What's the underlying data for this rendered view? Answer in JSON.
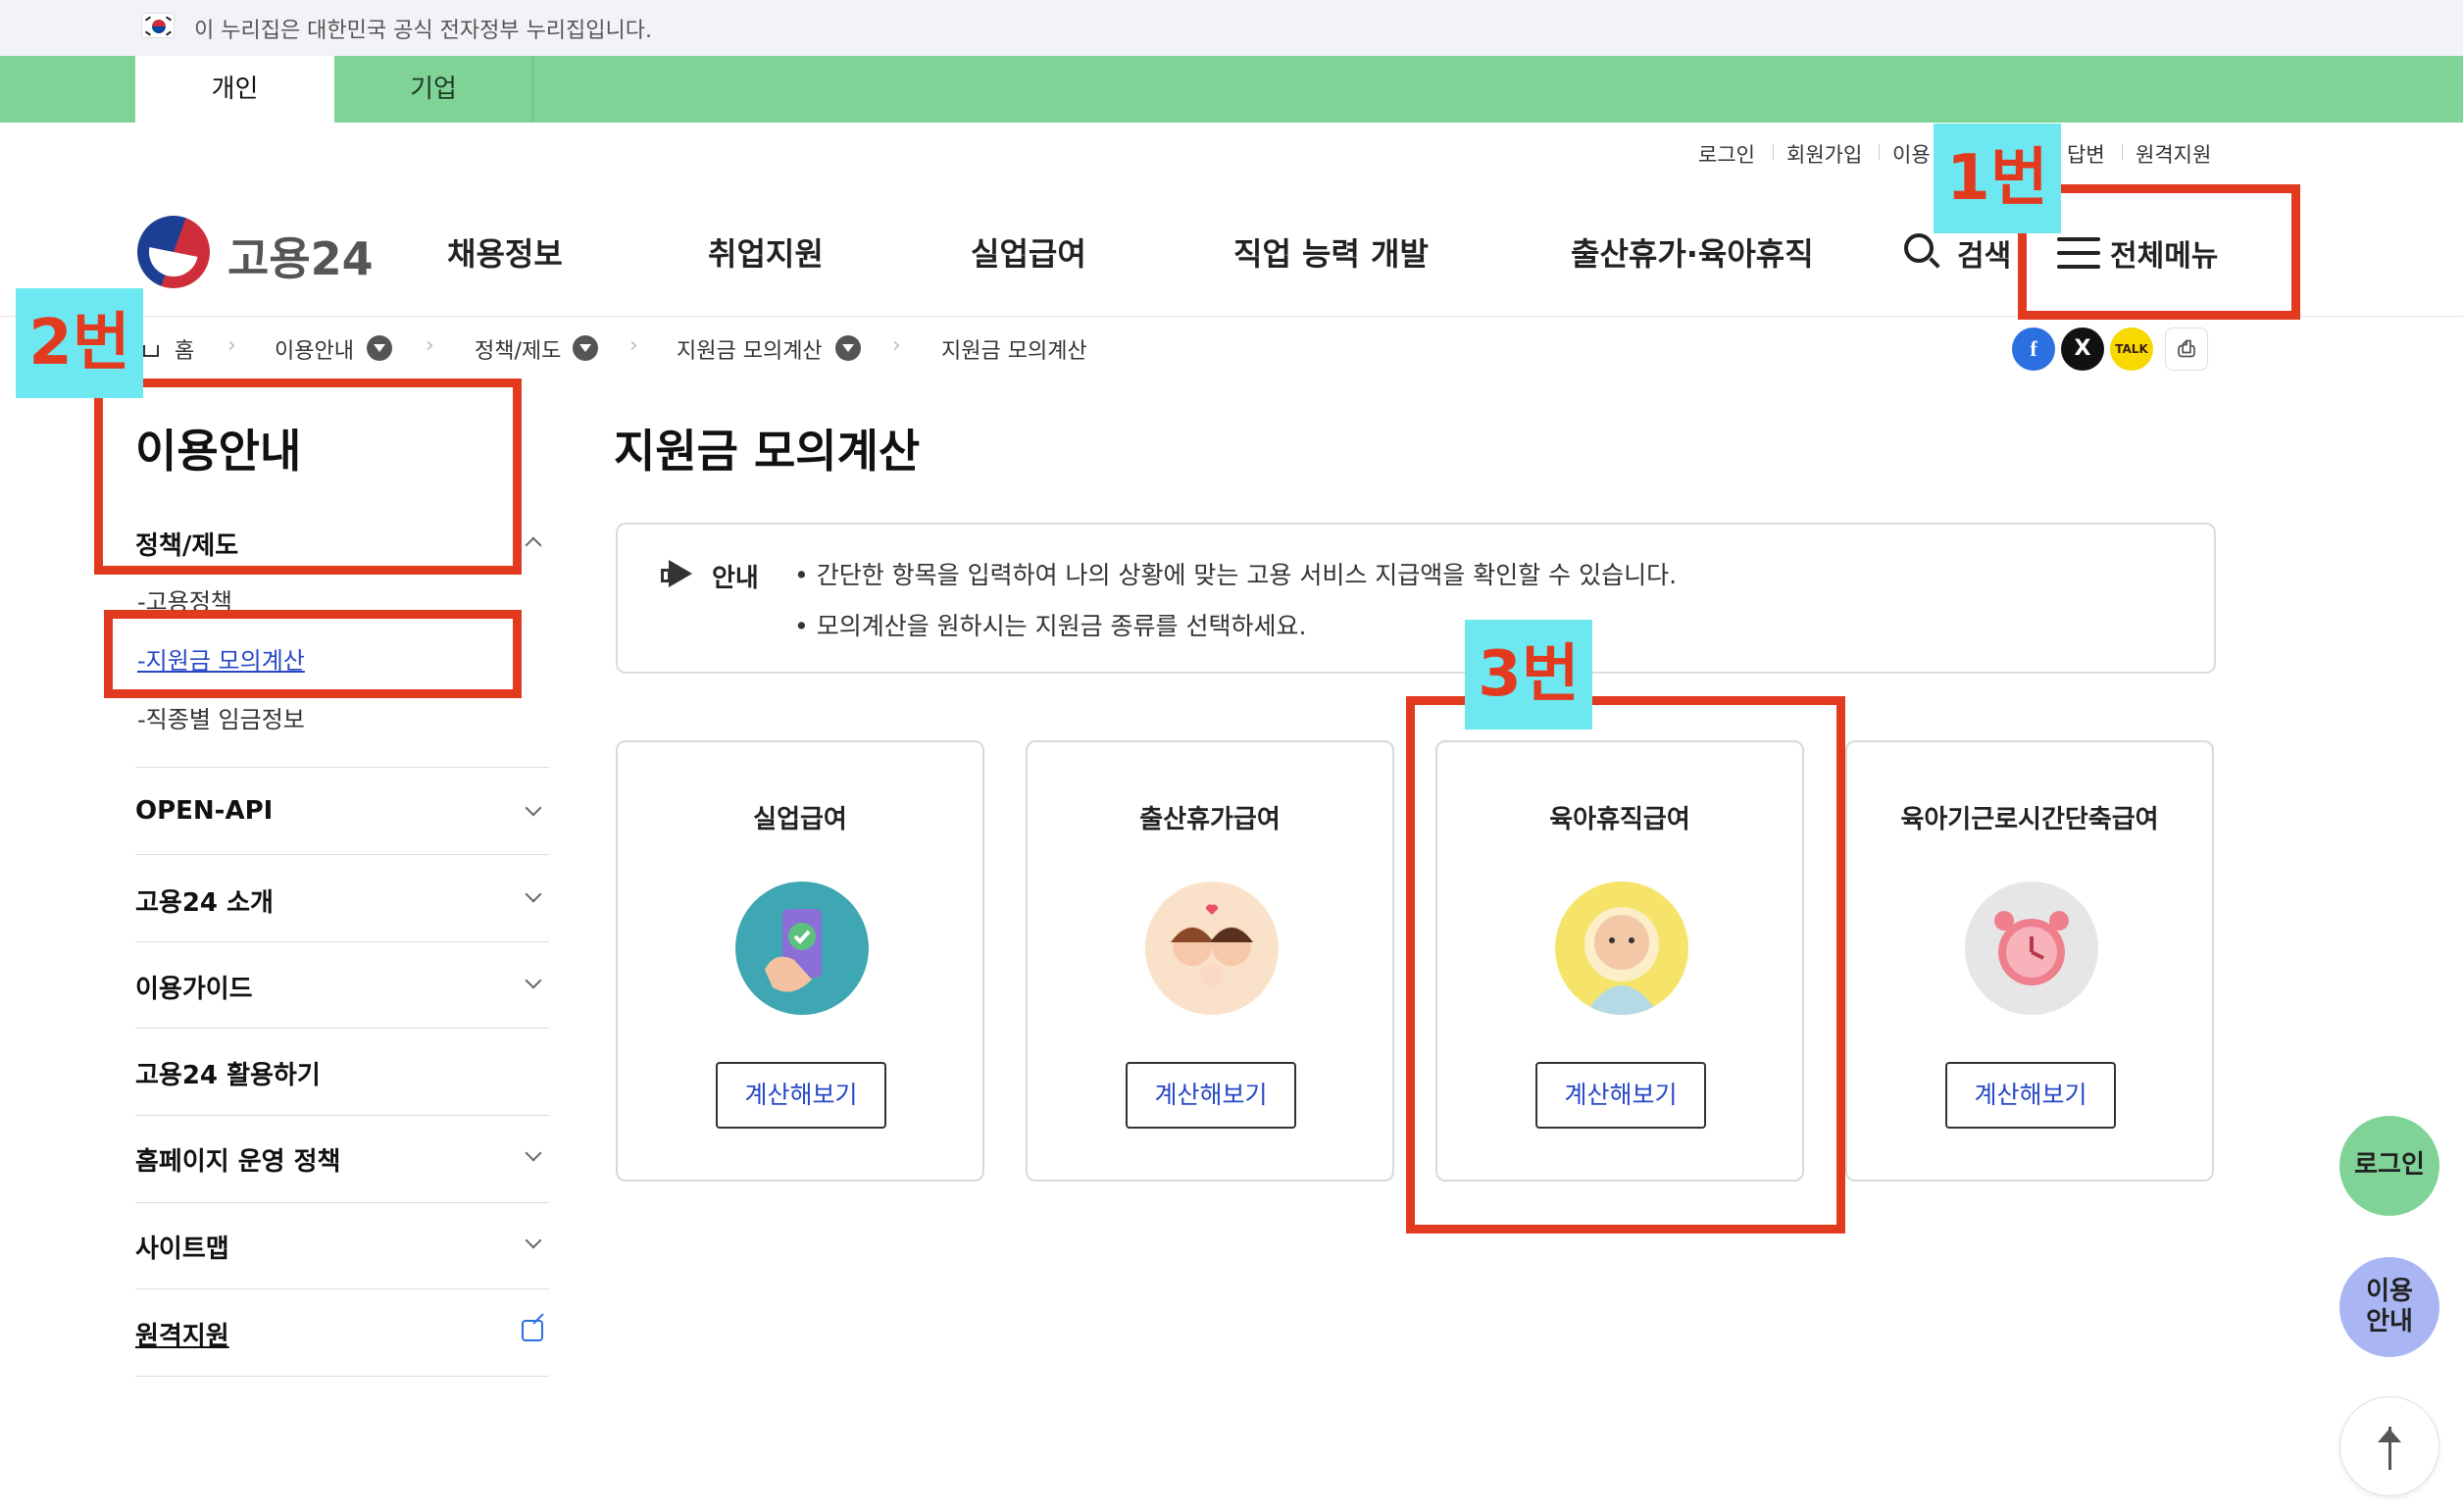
{
  "gov_banner": {
    "text": "이 누리집은 대한민국 공식 전자정부 누리집입니다."
  },
  "top_tabs": [
    {
      "label": "개인",
      "active": true
    },
    {
      "label": "기업",
      "active": false
    }
  ],
  "utility_links": {
    "login": "로그인",
    "signup": "회원가입",
    "usage": "이용",
    "answer": "답변",
    "remote": "원격지원"
  },
  "header": {
    "logo_text": "고용24",
    "nav": [
      "채용정보",
      "취업지원",
      "실업급여",
      "직업 능력 개발",
      "출산휴가·육아휴직"
    ],
    "search_label": "검색",
    "menu_label": "전체메뉴"
  },
  "breadcrumb": [
    "홈",
    "이용안내",
    "정책/제도",
    "지원금 모의계산",
    "지원금 모의계산"
  ],
  "share_icons": [
    "facebook-icon",
    "x-icon",
    "kakaotalk-icon",
    "print-icon"
  ],
  "sidebar": {
    "title": "이용안내",
    "section": "정책/제도",
    "subitems": [
      "-고용정책",
      "-지원금 모의계산",
      "-직종별 임금정보"
    ],
    "sections": [
      "OPEN-API",
      "고용24 소개",
      "이용가이드",
      "고용24 활용하기",
      "홈페이지 운영 정책",
      "사이트맵",
      "원격지원"
    ]
  },
  "main": {
    "title": "지원금 모의계산",
    "notice_label": "안내",
    "notice_lines": [
      "• 간단한 항목을 입력하여 나의 상황에 맞는 고용 서비스 지급액을 확인할 수 있습니다.",
      "• 모의계산을 원하시는 지원금 종류를 선택하세요."
    ],
    "cards": [
      {
        "title": "실업급여",
        "button": "계산해보기"
      },
      {
        "title": "출산휴가급여",
        "button": "계산해보기"
      },
      {
        "title": "육아휴직급여",
        "button": "계산해보기"
      },
      {
        "title": "육아기근로시간단축급여",
        "button": "계산해보기"
      }
    ]
  },
  "annotations": {
    "tag1": "1번",
    "tag2": "2번",
    "tag3": "3번",
    "color": "#e23a1f",
    "tag_bg": "#6ee8f0"
  },
  "floating": {
    "login": "로그인",
    "guide_line1": "이용",
    "guide_line2": "안내"
  },
  "colors": {
    "green_bar": "#80d396",
    "link_blue": "#2748c6"
  }
}
